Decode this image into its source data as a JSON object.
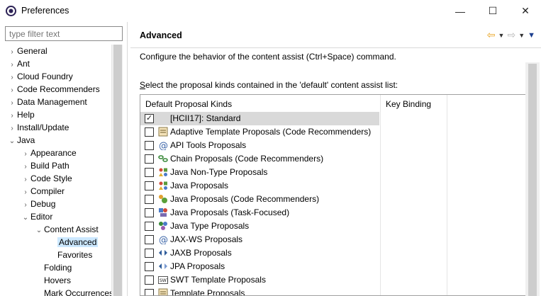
{
  "window": {
    "title": "Preferences",
    "min_glyph": "—",
    "max_glyph": "☐",
    "close_glyph": "✕"
  },
  "filter": {
    "placeholder": "type filter text"
  },
  "tree": [
    {
      "label": "General",
      "arrow": "›",
      "indent": 0
    },
    {
      "label": "Ant",
      "arrow": "›",
      "indent": 0
    },
    {
      "label": "Cloud Foundry",
      "arrow": "›",
      "indent": 0
    },
    {
      "label": "Code Recommenders",
      "arrow": "›",
      "indent": 0
    },
    {
      "label": "Data Management",
      "arrow": "›",
      "indent": 0
    },
    {
      "label": "Help",
      "arrow": "›",
      "indent": 0
    },
    {
      "label": "Install/Update",
      "arrow": "›",
      "indent": 0
    },
    {
      "label": "Java",
      "arrow": "⌄",
      "indent": 0
    },
    {
      "label": "Appearance",
      "arrow": "›",
      "indent": 1
    },
    {
      "label": "Build Path",
      "arrow": "›",
      "indent": 1
    },
    {
      "label": "Code Style",
      "arrow": "›",
      "indent": 1
    },
    {
      "label": "Compiler",
      "arrow": "›",
      "indent": 1
    },
    {
      "label": "Debug",
      "arrow": "›",
      "indent": 1
    },
    {
      "label": "Editor",
      "arrow": "⌄",
      "indent": 1
    },
    {
      "label": "Content Assist",
      "arrow": "⌄",
      "indent": 2
    },
    {
      "label": "Advanced",
      "arrow": "",
      "indent": 3,
      "selected": true
    },
    {
      "label": "Favorites",
      "arrow": "",
      "indent": 3
    },
    {
      "label": "Folding",
      "arrow": "",
      "indent": 2
    },
    {
      "label": "Hovers",
      "arrow": "",
      "indent": 2
    },
    {
      "label": "Mark Occurrences",
      "arrow": "",
      "indent": 2
    }
  ],
  "page": {
    "title": "Advanced",
    "description": "Configure the behavior of the content assist (Ctrl+Space) command.",
    "select_label_first": "S",
    "select_label_rest": "elect the proposal kinds contained in the 'default' content assist list:",
    "nav": {
      "back": "⇦",
      "drop": "▼",
      "forward": "⇨",
      "menu": "▼"
    }
  },
  "table": {
    "headers": {
      "kinds": "Default Proposal Kinds",
      "binding": "Key Binding"
    },
    "rows": [
      {
        "label": "[HCII17]: Standard",
        "checked": true,
        "icon": "none",
        "highlight": true
      },
      {
        "label": "Adaptive Template Proposals (Code Recommenders)",
        "checked": false,
        "icon": "template-icon"
      },
      {
        "label": "API Tools Proposals",
        "checked": false,
        "icon": "at-icon"
      },
      {
        "label": "Chain Proposals (Code Recommenders)",
        "checked": false,
        "icon": "chain-icon"
      },
      {
        "label": "Java Non-Type Proposals",
        "checked": false,
        "icon": "java-shapes-icon"
      },
      {
        "label": "Java Proposals",
        "checked": false,
        "icon": "java-shapes-icon"
      },
      {
        "label": "Java Proposals (Code Recommenders)",
        "checked": false,
        "icon": "recommender-icon"
      },
      {
        "label": "Java Proposals (Task-Focused)",
        "checked": false,
        "icon": "task-icon"
      },
      {
        "label": "Java Type Proposals",
        "checked": false,
        "icon": "type-icon"
      },
      {
        "label": "JAX-WS Proposals",
        "checked": false,
        "icon": "at-icon"
      },
      {
        "label": "JAXB Proposals",
        "checked": false,
        "icon": "jaxb-icon"
      },
      {
        "label": "JPA Proposals",
        "checked": false,
        "icon": "jpa-icon"
      },
      {
        "label": "SWT Template Proposals",
        "checked": false,
        "icon": "swt-icon"
      },
      {
        "label": "Template Proposals",
        "checked": false,
        "icon": "template-icon"
      }
    ]
  },
  "colors": {
    "selection": "#cce8ff",
    "row_highlight": "#d9d9d9",
    "accent_back": "#e8a11b"
  }
}
